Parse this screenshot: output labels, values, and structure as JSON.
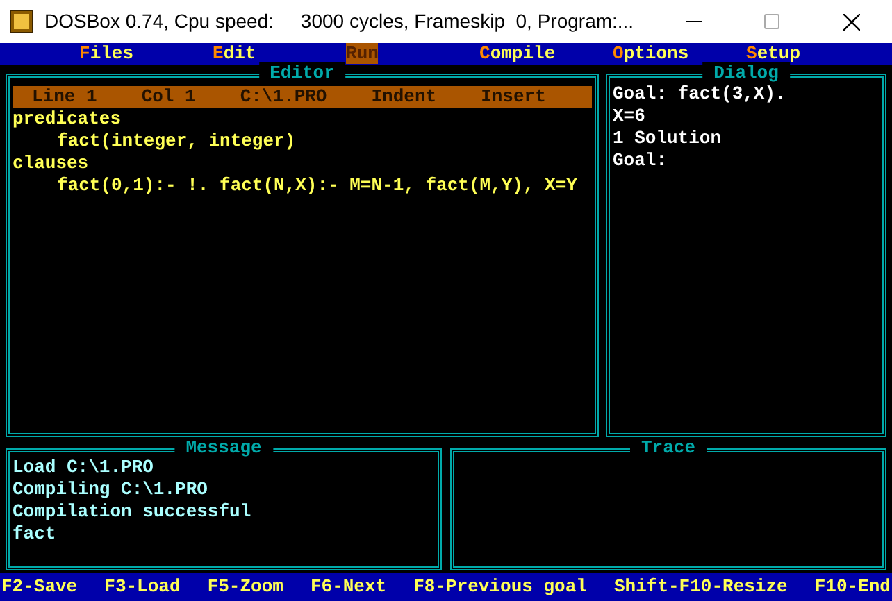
{
  "window": {
    "title": "DOSBox 0.74, Cpu speed:     3000 cycles, Frameskip  0, Program:..."
  },
  "menu": [
    {
      "label": "Files",
      "selected": false
    },
    {
      "label": "Edit",
      "selected": false
    },
    {
      "label": "Run",
      "selected": true
    },
    {
      "label": "Compile",
      "selected": false
    },
    {
      "label": "Options",
      "selected": false
    },
    {
      "label": "Setup",
      "selected": false
    }
  ],
  "editor": {
    "title": "Editor",
    "status": [
      "Line 1",
      "Col 1",
      "C:\\1.PRO",
      "Indent",
      "Insert"
    ],
    "lines": [
      {
        "text": "predicates",
        "children": [
          {
            "text": "fact(integer, integer)"
          }
        ]
      },
      {
        "text": "clauses",
        "children": [
          {
            "text": "fact(0,1):- !. fact(N,X):- M=N-1, fact(M,Y), X=Y"
          }
        ]
      }
    ]
  },
  "dialog": {
    "title": "Dialog",
    "lines": [
      "Goal: fact(3,X).",
      "X=6",
      "1 Solution",
      "Goal:"
    ]
  },
  "message": {
    "title": "Message",
    "lines": [
      "Load C:\\1.PRO",
      "Compiling C:\\1.PRO",
      "Compilation successful",
      "fact"
    ]
  },
  "trace": {
    "title": "Trace"
  },
  "status_bar": [
    "F2-Save",
    "F3-Load",
    "F5-Zoom",
    "F6-Next",
    "F8-Previous goal",
    "Shift-F10-Resize",
    "F10-End"
  ]
}
